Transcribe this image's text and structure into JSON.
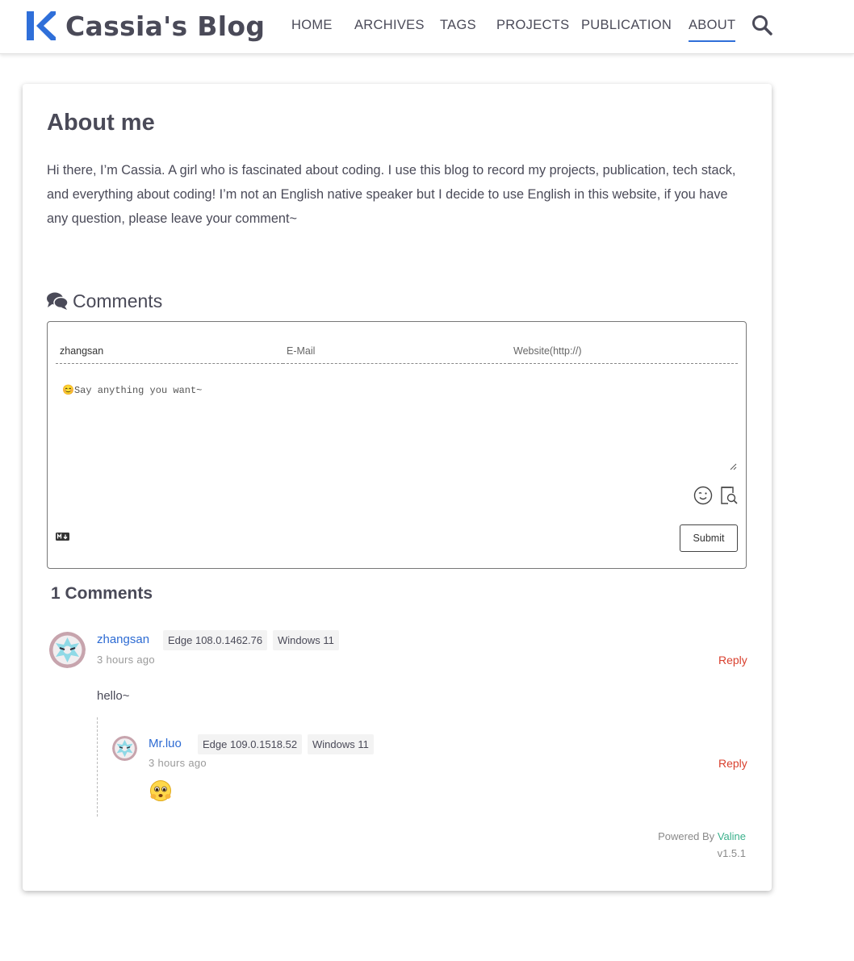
{
  "header": {
    "site_title": "Cassia's Blog",
    "nav": [
      "HOME",
      "ARCHIVES",
      "TAGS",
      "PROJECTS",
      "PUBLICATION",
      "ABOUT"
    ],
    "active_nav": "ABOUT",
    "accent_color": "#2f6fd9"
  },
  "page": {
    "title": "About me",
    "intro": "Hi there, I’m Cassia. A girl who is fascinated about coding. I use this blog to record my projects, publication, tech stack, and everything about coding! I’m not an English native speaker but I decide to use English in this website, if you have any question, please leave your comment~"
  },
  "comments": {
    "heading": "Comments",
    "form": {
      "name_value": "zhangsan",
      "mail_placeholder": "E-Mail",
      "site_placeholder": "Website(http://)",
      "content_placeholder": "😊Say anything you want~",
      "submit_label": "Submit"
    },
    "count_label": "1 Comments",
    "items": [
      {
        "nick": "zhangsan",
        "browser": "Edge 108.0.1462.76",
        "os": "Windows 11",
        "time": "3 hours ago",
        "reply_label": "Reply",
        "content": "hello~",
        "children": [
          {
            "nick": "Mr.luo",
            "browser": "Edge 109.0.1518.52",
            "os": "Windows 11",
            "time": "3 hours ago",
            "reply_label": "Reply",
            "content_emoji": "worried-face-emoji"
          }
        ]
      }
    ],
    "powered_by_prefix": "Powered By",
    "powered_by_link": "Valine",
    "version": "v1.5.1"
  }
}
